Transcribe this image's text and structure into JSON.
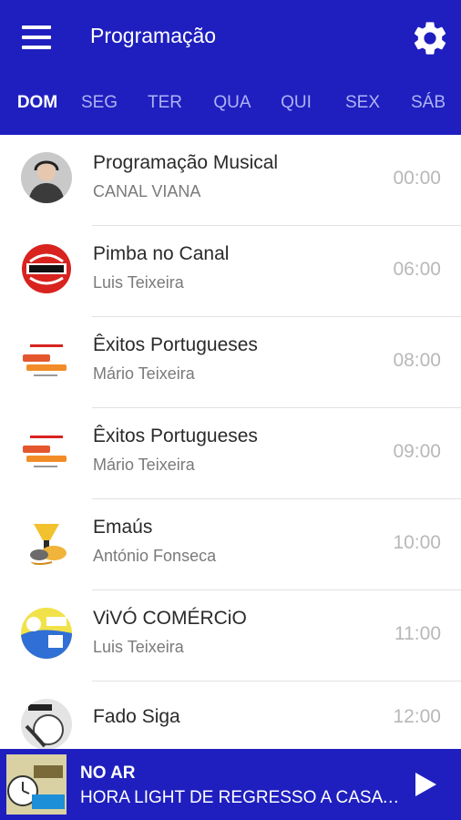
{
  "header": {
    "title": "Programação",
    "menu_icon": "hamburger-menu-icon",
    "settings_icon": "gear-icon",
    "background": "#1f1fbf"
  },
  "tabs": [
    {
      "label": "DOM",
      "active": true
    },
    {
      "label": "SEG",
      "active": false
    },
    {
      "label": "TER",
      "active": false
    },
    {
      "label": "QUA",
      "active": false
    },
    {
      "label": "QUI",
      "active": false
    },
    {
      "label": "SEX",
      "active": false
    },
    {
      "label": "SÁB",
      "active": false
    }
  ],
  "schedule": [
    {
      "name": "Programação Musical",
      "host": "CANAL VIANA",
      "time": "00:00",
      "icon": "host-photo-avatar"
    },
    {
      "name": "Pimba no Canal",
      "host": "Luis Teixeira",
      "time": "06:00",
      "icon": "pimba-logo"
    },
    {
      "name": "Êxitos Portugueses",
      "host": "Mário Teixeira",
      "time": "08:00",
      "icon": "exitos-logo"
    },
    {
      "name": "Êxitos Portugueses",
      "host": "Mário Teixeira",
      "time": "09:00",
      "icon": "exitos-logo"
    },
    {
      "name": "Emaús",
      "host": "António Fonseca",
      "time": "10:00",
      "icon": "emaus-logo"
    },
    {
      "name": "ViVÓ COMÉRCiO",
      "host": "Luis Teixeira",
      "time": "11:00",
      "icon": "vivo-comercio-logo"
    },
    {
      "name": "Fado Siga",
      "host": "",
      "time": "12:00",
      "icon": "fado-siga-logo"
    }
  ],
  "player": {
    "status": "NO AR",
    "now_playing": "HORA LIGHT DE REGRESSO A CASA ...",
    "cover_icon": "hora-light-cover",
    "play_icon": "play-icon"
  }
}
